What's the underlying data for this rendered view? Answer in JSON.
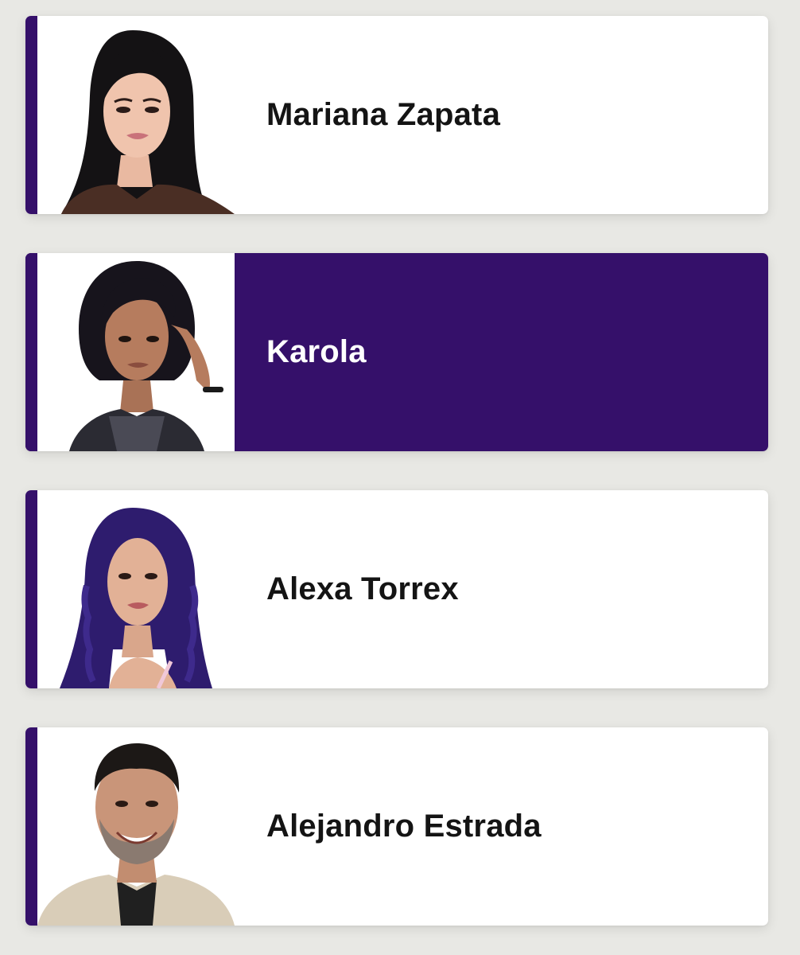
{
  "contestants": [
    {
      "name": "Mariana Zapata",
      "selected": false,
      "photo_icon": "portrait-woman-long-black-hair"
    },
    {
      "name": "Karola",
      "selected": true,
      "photo_icon": "portrait-woman-short-black-hair"
    },
    {
      "name": "Alexa Torrex",
      "selected": false,
      "photo_icon": "portrait-woman-wavy-purple-hair"
    },
    {
      "name": "Alejandro Estrada",
      "selected": false,
      "photo_icon": "portrait-man-dark-hair-beard"
    }
  ],
  "colors": {
    "accent": "#35106a",
    "background": "#e8e8e4",
    "card": "#ffffff",
    "name_text": "#141414",
    "selected_text": "#ffffff"
  }
}
